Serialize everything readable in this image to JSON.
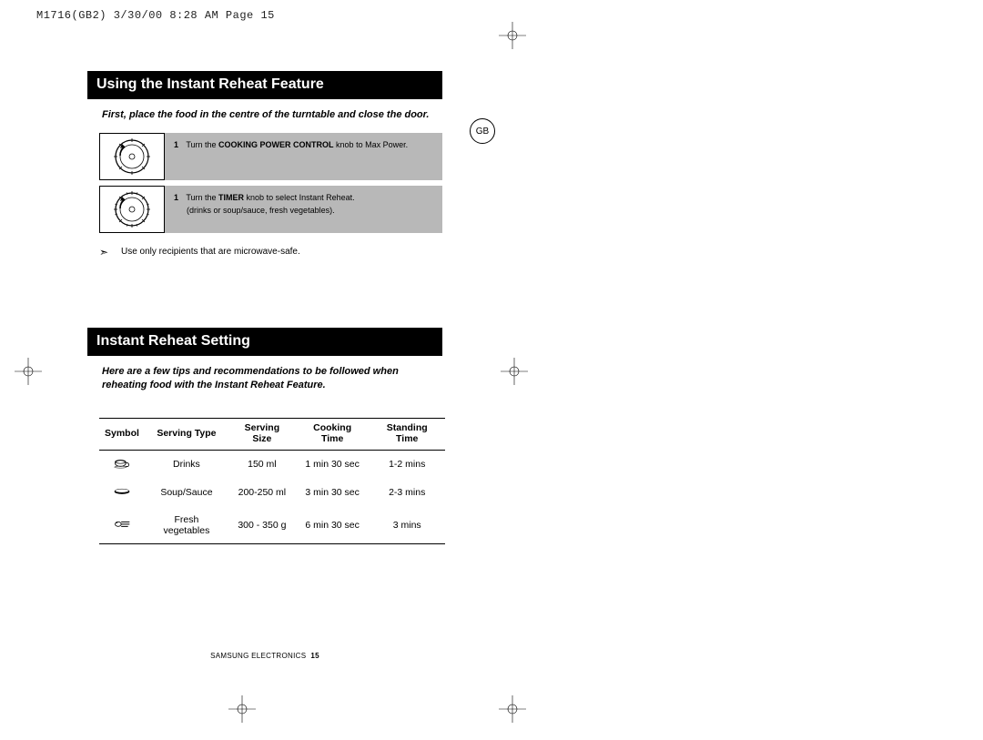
{
  "header": "M1716(GB2)  3/30/00 8:28 AM  Page 15",
  "region_badge": "GB",
  "section1": {
    "title": "Using the Instant Reheat Feature",
    "intro": "First, place the food in the centre of the turntable and close the door.",
    "step1_num": "1",
    "step1_prefix": "Turn the ",
    "step1_bold": "COOKING POWER CONTROL",
    "step1_suffix": " knob to Max Power.",
    "step2_num": "1",
    "step2_prefix": "Turn the ",
    "step2_bold": "TIMER",
    "step2_suffix": "  knob to select Instant Reheat.",
    "step2_line2": "(drinks or soup/sauce, fresh vegetables).",
    "note": "Use only recipients that are microwave-safe."
  },
  "section2": {
    "title": "Instant Reheat Setting",
    "intro": "Here are a few tips and recommendations to be followed when reheating food with the Instant Reheat  Feature.",
    "headers": {
      "symbol": "Symbol",
      "serving_type": "Serving Type",
      "serving_size": "Serving Size",
      "cooking_time": "Cooking Time",
      "standing_time": "Standing Time"
    },
    "rows": [
      {
        "symbol": "cup",
        "type": "Drinks",
        "size": "150 ml",
        "cook": "1 min 30 sec",
        "stand": "1-2 mins"
      },
      {
        "symbol": "bowl",
        "type": "Soup/Sauce",
        "size": "200-250 ml",
        "cook": "3 min 30 sec",
        "stand": "2-3 mins"
      },
      {
        "symbol": "veg",
        "type": "Fresh vegetables",
        "size": "300 - 350 g",
        "cook": "6 min 30 sec",
        "stand": "3 mins"
      }
    ]
  },
  "footer_brand": "SAMSUNG ELECTRONICS",
  "footer_page": "15"
}
